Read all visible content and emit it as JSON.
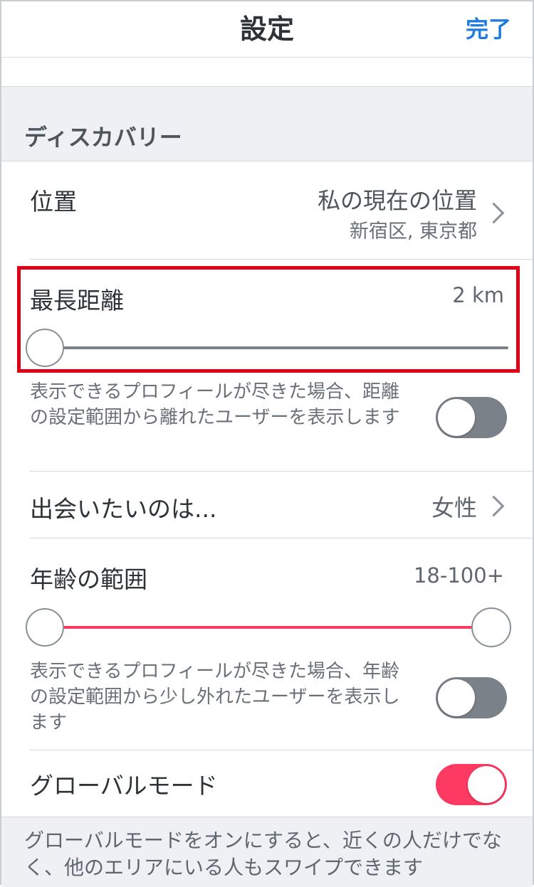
{
  "nav": {
    "title": "設定",
    "done": "完了"
  },
  "section": {
    "title": "ディスカバリー"
  },
  "location": {
    "label": "位置",
    "value": "私の現在の位置",
    "sub": "新宿区, 東京都"
  },
  "distance": {
    "label": "最長距離",
    "value": "2 km",
    "slider_fraction": 0.0,
    "description": "表示できるプロフィールが尽きた場合、距離の設定範囲から離れたユーザーを表示します",
    "toggle_on": false
  },
  "interest": {
    "label": "出会いたいのは...",
    "value": "女性"
  },
  "age": {
    "label": "年齢の範囲",
    "value": "18-100+",
    "range_min_fraction": 0.0,
    "range_max_fraction": 1.0,
    "description": "表示できるプロフィールが尽きた場合、年齢の設定範囲から少し外れたユーザーを表示します",
    "toggle_on": false
  },
  "global": {
    "label": "グローバルモード",
    "toggle_on": true
  },
  "footer": {
    "text": "グローバルモードをオンにすると、近くの人だけでなく、他のエリアにいる人もスワイプできます"
  },
  "colors": {
    "accent": "#fd3a61",
    "link": "#1f7cdc",
    "highlight": "#e00016"
  }
}
